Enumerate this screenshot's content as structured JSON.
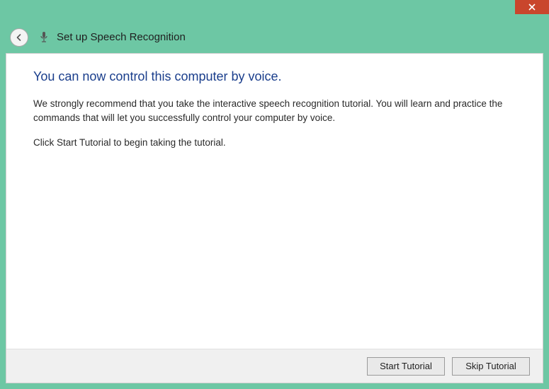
{
  "titlebar": {
    "close_label": "Close"
  },
  "header": {
    "title": "Set up Speech Recognition"
  },
  "main": {
    "heading": "You can now control this computer by voice.",
    "paragraph1": "We strongly recommend that you take the interactive speech recognition tutorial. You will learn and practice the commands that will let you successfully control your computer by voice.",
    "paragraph2": "Click Start Tutorial to begin taking the tutorial."
  },
  "footer": {
    "start_label": "Start Tutorial",
    "skip_label": "Skip Tutorial"
  },
  "colors": {
    "accent": "#6dc7a4",
    "heading": "#1a3e8c",
    "close": "#c9462c"
  }
}
